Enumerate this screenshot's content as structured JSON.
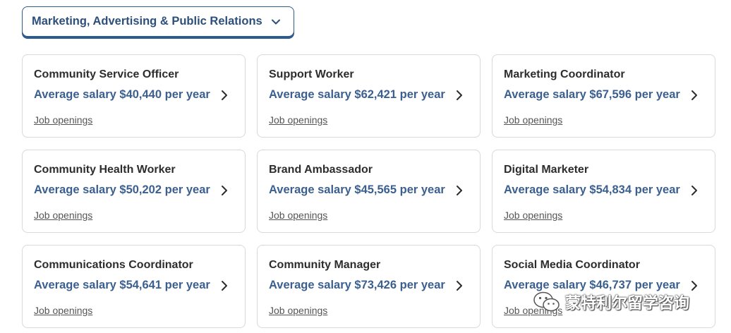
{
  "filter": {
    "selected": "Marketing, Advertising & Public Relations"
  },
  "cards": [
    {
      "title": "Community Service Officer",
      "salary": "Average salary $40,440 per year",
      "link": "Job openings"
    },
    {
      "title": "Support Worker",
      "salary": "Average salary $62,421 per year",
      "link": "Job openings"
    },
    {
      "title": "Marketing Coordinator",
      "salary": "Average salary $67,596 per year",
      "link": "Job openings"
    },
    {
      "title": "Community Health Worker",
      "salary": "Average salary $50,202 per year",
      "link": "Job openings"
    },
    {
      "title": "Brand Ambassador",
      "salary": "Average salary $45,565 per year",
      "link": "Job openings"
    },
    {
      "title": "Digital Marketer",
      "salary": "Average salary $54,834 per year",
      "link": "Job openings"
    },
    {
      "title": "Communications Coordinator",
      "salary": "Average salary $54,641 per year",
      "link": "Job openings"
    },
    {
      "title": "Community Manager",
      "salary": "Average salary $73,426 per year",
      "link": "Job openings"
    },
    {
      "title": "Social Media Coordinator",
      "salary": "Average salary $46,737 per year",
      "link": "Job openings"
    }
  ],
  "watermark": {
    "text": "蒙特利尔留学咨询"
  },
  "colors": {
    "accent": "#3b5f8f",
    "border": "#d9d9d9",
    "title": "#2d2d2d"
  }
}
